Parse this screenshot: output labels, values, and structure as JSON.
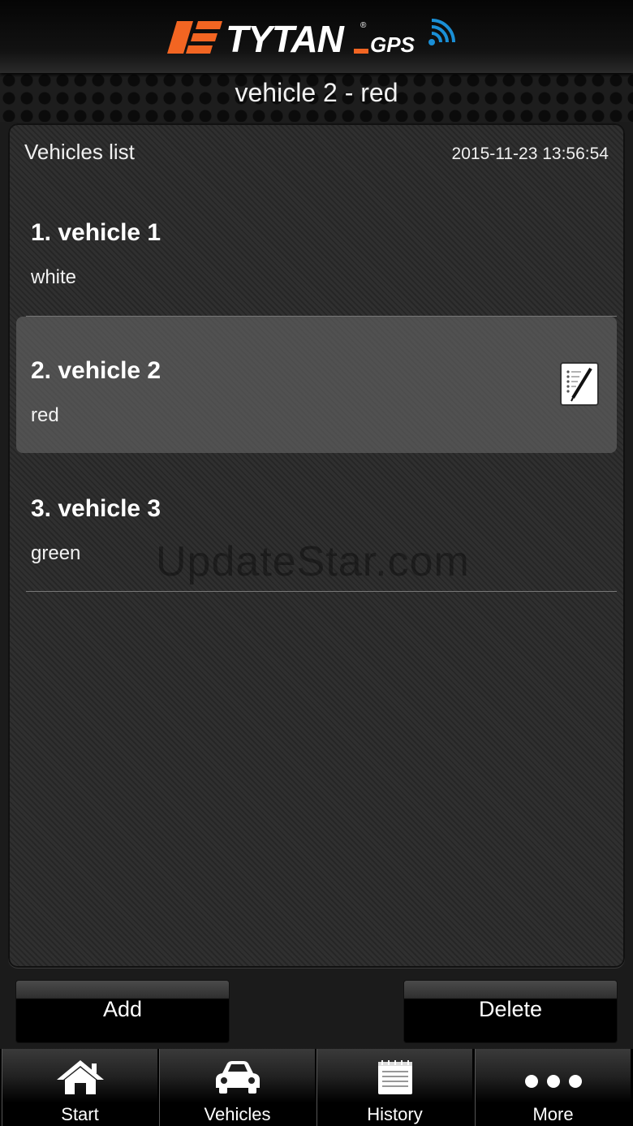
{
  "header": {
    "logo_text": "TYTAN GPS",
    "vehicle_title": "vehicle 2 - red"
  },
  "panel": {
    "title": "Vehicles list",
    "datetime": "2015-11-23 13:56:54",
    "vehicles": [
      {
        "name": "1. vehicle  1",
        "color": "white",
        "selected": false
      },
      {
        "name": "2. vehicle 2",
        "color": "red",
        "selected": true
      },
      {
        "name": "3. vehicle 3",
        "color": "green",
        "selected": false
      }
    ],
    "watermark": "UpdateStar.com"
  },
  "actions": {
    "add_label": "Add",
    "delete_label": "Delete"
  },
  "tabs": [
    {
      "label": "Start",
      "icon": "home-icon"
    },
    {
      "label": "Vehicles",
      "icon": "car-icon"
    },
    {
      "label": "History",
      "icon": "notepad-icon"
    },
    {
      "label": "More",
      "icon": "more-dots-icon"
    }
  ],
  "colors": {
    "logo_orange": "#f26522",
    "logo_blue": "#1a8fd6"
  }
}
